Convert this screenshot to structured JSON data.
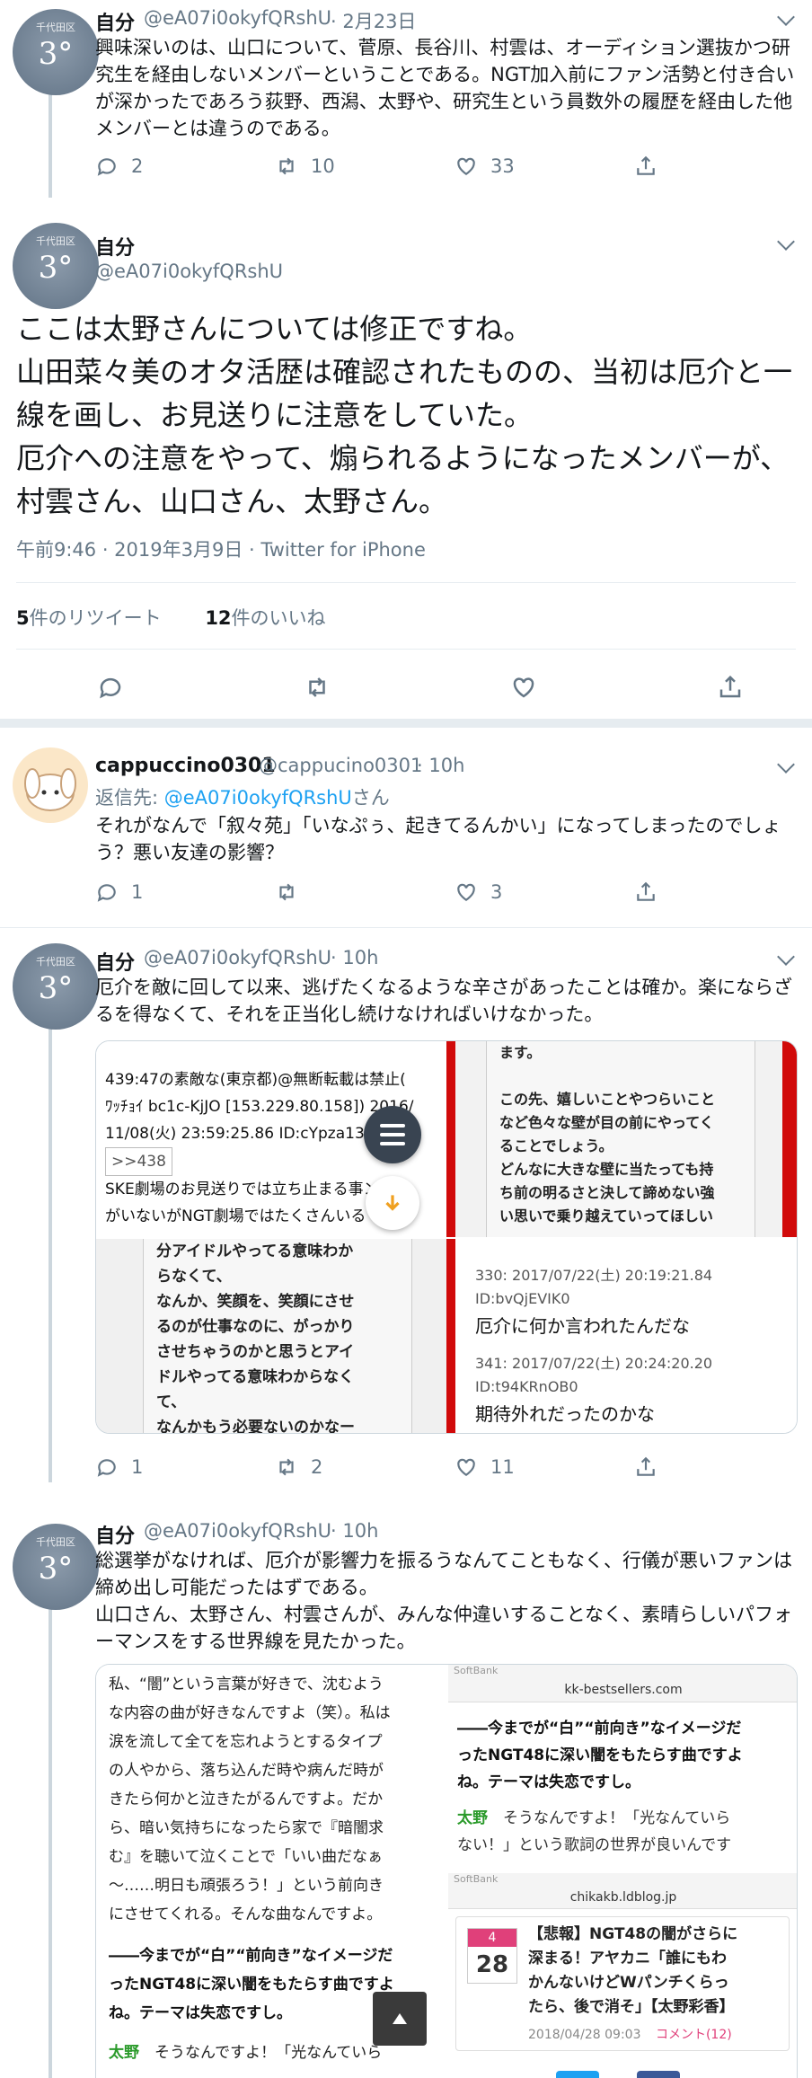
{
  "tweets": [
    {
      "avatar_top": "千代田区",
      "avatar_num": "3°",
      "name": "自分",
      "handle": "@eA07i0okyfQRshU",
      "time": "· 2月23日",
      "text": "興味深いのは、山口について、菅原、長谷川、村雲は、オーディション選抜かつ研究生を経由しないメンバーということである。NGT加入前にファン活勢と付き合いが深かったであろう荻野、西潟、太野や、研究生という員数外の履歴を経由した他メンバーとは違うのである。",
      "replies": "2",
      "retweets": "10",
      "likes": "33"
    }
  ],
  "main_tweet": {
    "avatar_top": "千代田区",
    "avatar_num": "3°",
    "name": "自分",
    "handle": "@eA07i0okyfQRshU",
    "text": "ここは太野さんについては修正ですね。\n山田菜々美のオタ活歴は確認されたものの、当初は厄介と一線を画し、お見送りに注意をしていた。\n厄介への注意をやって、煽られるようになったメンバーが、村雲さん、山口さん、太野さん。",
    "timestamp": "午前9:46 · 2019年3月9日 · Twitter for iPhone",
    "rt_count": "5",
    "rt_label": "件のリツイート",
    "like_count": "12",
    "like_label": "件のいいね"
  },
  "reply1": {
    "name": "cappuccino0301",
    "handle": "@cappucino0301",
    "time": "· 10h",
    "reply_prefix": "返信先: ",
    "reply_link": "@eA07i0okyfQRshU",
    "reply_suffix": "さん",
    "text": "それがなんで「叙々苑」「いなぷぅ、起きてるんかい」になってしまったのでしょう？悪い友達の影響？",
    "replies": "1",
    "retweets": "",
    "likes": "3"
  },
  "reply2": {
    "avatar_top": "千代田区",
    "avatar_num": "3°",
    "name": "自分",
    "handle": "@eA07i0okyfQRshU",
    "time": "· 10h",
    "text": "厄介を敵に回して以来、逃げたくなるような辛さがあったことは確か。楽にならざるを得なくて、それを正当化し続けなければいけなかった。",
    "replies": "1",
    "retweets": "2",
    "likes": "11",
    "media": {
      "p1_lines": [
        "439:47の素敵な(東京都)@無断転載は禁止(",
        "ﾜｯﾁｮｲ bc1c-KjJO [153.229.80.158])  2016/",
        "11/08(火) 23:59:25.86 ID:cYpza13",
        ">>438",
        "SKE劇場のお見送りでは立ち止まる事ン",
        "がいないがNGT劇場ではたくさんいる"
      ],
      "p2_lines": [
        "ます。",
        "",
        "この先、嬉しいことやつらいこと",
        "など色々な壁が目の前にやってく",
        "ることでしょう。",
        "どんなに大きな壁に当たっても持",
        "ち前の明るさと決して諦めない強",
        "い思いで乗り越えていってほしい",
        "と思います。"
      ],
      "p3_lines": [
        "分アイドルやってる意味わか",
        "らなくて、",
        "なんか、笑顔を、笑顔にさせ",
        "るのが仕事なのに、がっかり",
        "させちゃうのかと思うとアイ",
        "ドルやってる意味わからなく",
        "て、",
        "なんかもう必要ないのかなー"
      ],
      "p4_a_head": "330:    2017/07/22(土) 20:19:21.84",
      "p4_a_id": "ID:bvQjEVIK0",
      "p4_a_text": "厄介に何か言われたんだな",
      "p4_b_head": "341:    2017/07/22(土) 20:24:20.20",
      "p4_b_id": "ID:t94KRnOB0",
      "p4_b_text": "期待外れだったのかな"
    }
  },
  "reply3": {
    "avatar_top": "千代田区",
    "avatar_num": "3°",
    "name": "自分",
    "handle": "@eA07i0okyfQRshU",
    "time": "· 10h",
    "text": "総選挙がなければ、厄介が影響力を振るうなんてこともなく、行儀が悪いファンは締め出し可能だったはずである。\n山口さん、太野さん、村雲さんが、みんな仲違いすることなく、素晴らしいパフォーマンスをする世界線を見たかった。",
    "media": {
      "left_lines": [
        "私、“闇”という言葉が好きで、沈むよう",
        "な内容の曲が好きなんですよ（笑）。私は",
        "涙を流して全てを忘れようとするタイプ",
        "の人やから、落ち込んだ時や病んだ時が",
        "きたら何かと泣きたがるんですよ。だか",
        "ら、暗い気持ちになったら家で『暗闇求",
        "む』を聴いて泣くことで「いい曲だなぁ",
        "〜……明日も頑張ろう！」という前向き",
        "にさせてくれる。そんな曲なんですよ。"
      ],
      "left_bold": [
        "――今までが“白”“前向き”なイメージだ",
        "ったNGT48に深い闇をもたらす曲ですよ",
        "ね。テーマは失恋ですし。"
      ],
      "left_green": "太野",
      "left_last": "そうなんですよ！「光なんていら",
      "rt_status": "SoftBank",
      "rt_url": "kk-bestsellers.com",
      "rt_bold": [
        "――今までが“白”“前向き”なイメージだ",
        "ったNGT48に深い闇をもたらす曲ですよ",
        "ね。テーマは失恋ですし。"
      ],
      "rt_green": "太野",
      "rt_quote": [
        "そうなんですよ！「光なんていら",
        "ない！」という歌詞の世界が良いんです"
      ],
      "rb_status": "SoftBank",
      "rb_url": "chikakb.ldblog.jp",
      "cal_month": "4",
      "cal_day": "28",
      "news_lines": [
        "【悲報】NGT48の闇がさらに",
        "深まる！アヤカニ「誰にもわ",
        "かんないけどWパンチくらっ",
        "たら、後で消そ」【太野彩香】"
      ],
      "news_date": "2018/04/28 09:03",
      "news_comments": "コメント(12)"
    }
  },
  "icons": {
    "reply": "reply-icon",
    "retweet": "retweet-icon",
    "like": "like-icon",
    "share": "share-icon",
    "menu": "menu-icon",
    "download": "download-arrow-icon",
    "scroll_top": "scroll-to-top-icon"
  },
  "colors": {
    "link": "#1da1f2",
    "muted": "#657786",
    "divider": "#e6ecf0",
    "accent_red": "#d10a0a"
  }
}
